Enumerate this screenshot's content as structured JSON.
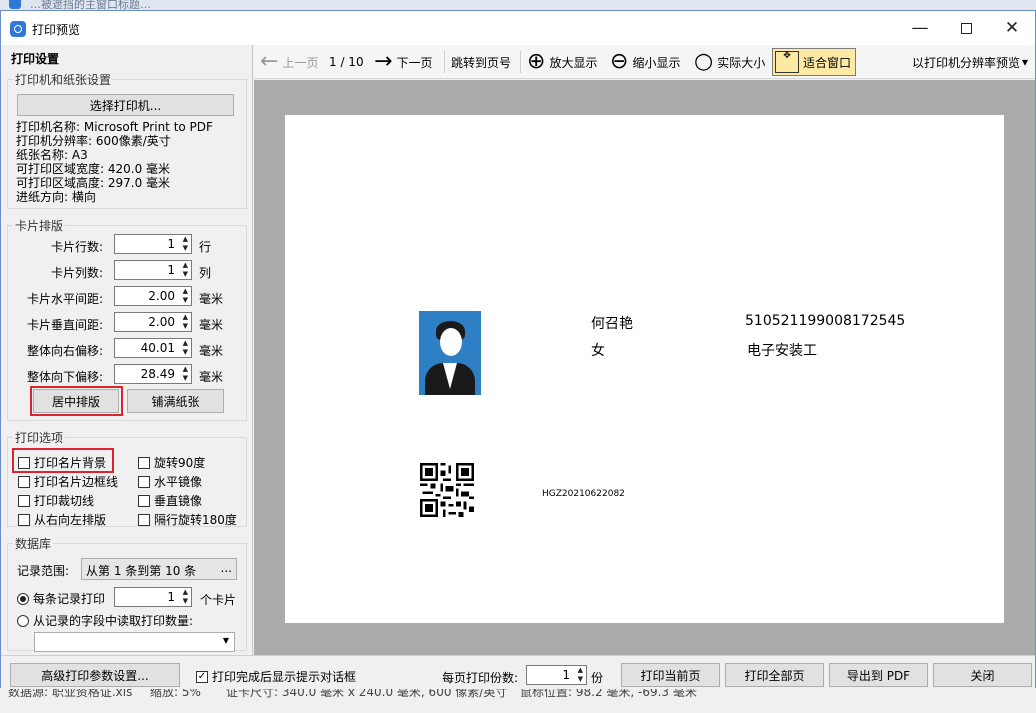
{
  "behind_window": {
    "title": "…被遮挡的主窗口标题…"
  },
  "window": {
    "title": "打印预览",
    "minimize": "—",
    "close": "✕"
  },
  "left_panel": {
    "title": "打印设置",
    "printer_group": {
      "label": "打印机和纸张设置",
      "select_button": "选择打印机...",
      "lines": [
        "打印机名称: Microsoft Print to PDF",
        "打印机分辨率: 600像素/英寸",
        "纸张名称: A3",
        "可打印区域宽度: 420.0 毫米",
        "可打印区域高度: 297.0 毫米",
        "进纸方向: 横向"
      ]
    },
    "layout_group": {
      "label": "卡片排版",
      "rows": [
        {
          "label": "卡片行数:",
          "value": "1",
          "unit": "行"
        },
        {
          "label": "卡片列数:",
          "value": "1",
          "unit": "列"
        },
        {
          "label": "卡片水平间距:",
          "value": "2.00",
          "unit": "毫米"
        },
        {
          "label": "卡片垂直间距:",
          "value": "2.00",
          "unit": "毫米"
        },
        {
          "label": "整体向右偏移:",
          "value": "40.01",
          "unit": "毫米"
        },
        {
          "label": "整体向下偏移:",
          "value": "28.49",
          "unit": "毫米"
        }
      ],
      "center_button": "居中排版",
      "fill_button": "铺满纸张"
    },
    "options_group": {
      "label": "打印选项",
      "options": [
        {
          "label": "打印名片背景",
          "checked": false
        },
        {
          "label": "旋转90度",
          "checked": false
        },
        {
          "label": "打印名片边框线",
          "checked": false
        },
        {
          "label": "水平镜像",
          "checked": false
        },
        {
          "label": "打印裁切线",
          "checked": false
        },
        {
          "label": "垂直镜像",
          "checked": false
        },
        {
          "label": "从右向左排版",
          "checked": false
        },
        {
          "label": "隔行旋转180度",
          "checked": false
        }
      ]
    },
    "database_group": {
      "label": "数据库",
      "range_label": "记录范围:",
      "range_value": "从第 1 条到第 10 条",
      "range_more": "...",
      "per_record_label": "每条记录打印",
      "per_record_value": "1",
      "per_record_unit": "个卡片",
      "from_field_label": "从记录的字段中读取打印数量:",
      "from_field_value": ""
    }
  },
  "toolbar": {
    "prev": "上一页",
    "page": "1 / 10",
    "next": "下一页",
    "goto": "跳转到页号",
    "zoom_in": "放大显示",
    "zoom_out": "缩小显示",
    "actual": "实际大小",
    "fit": "适合窗口",
    "resolution": "以打印机分辨率预览",
    "resolution_arrow": "▾"
  },
  "card": {
    "name": "何召艳",
    "id_number": "510521199008172545",
    "gender": "女",
    "job": "电子安装工",
    "code": "HGZ20210622082"
  },
  "bottom": {
    "advanced": "高级打印参数设置...",
    "show_dialog": "打印完成后显示提示对话框",
    "show_dialog_checked": true,
    "copies_label": "每页打印份数:",
    "copies_value": "1",
    "copies_unit": "份",
    "print_current": "打印当前页",
    "print_all": "打印全部页",
    "export_pdf": "导出到 PDF",
    "close": "关闭"
  },
  "status_bar": {
    "datasource": "数据源: 职业资格证.xls",
    "zoom": "缩放: 5%",
    "card_size": "证卡尺寸: 340.0 毫米 x 240.0 毫米, 600 像素/英寸",
    "mouse": "鼠标位置: 98.2 毫米, -69.3 毫米"
  },
  "colors": {
    "highlight_red": "#d9262d",
    "fit_active": "#fde9a4",
    "preview_bg": "#ababab",
    "photo_bg": "#2f7fc4"
  }
}
